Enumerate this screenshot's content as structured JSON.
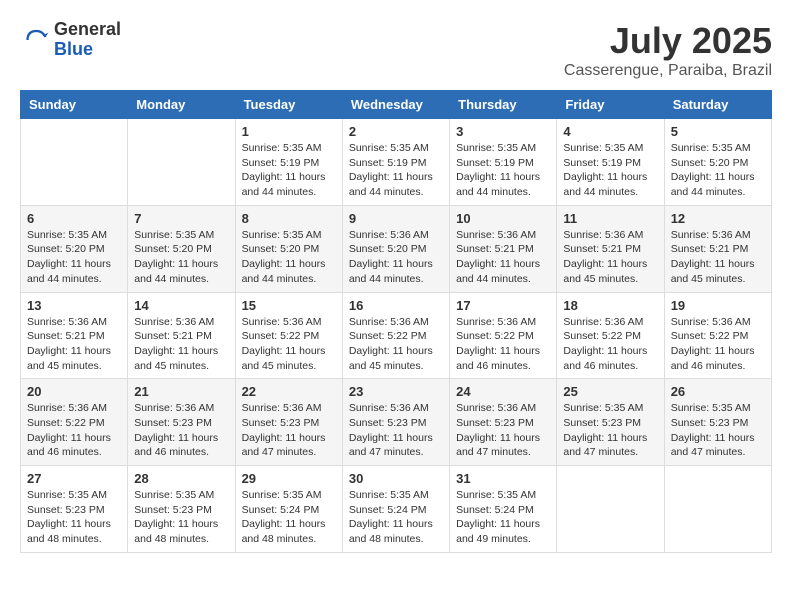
{
  "logo": {
    "general": "General",
    "blue": "Blue"
  },
  "title": {
    "month_year": "July 2025",
    "location": "Casserengue, Paraiba, Brazil"
  },
  "weekdays": [
    "Sunday",
    "Monday",
    "Tuesday",
    "Wednesday",
    "Thursday",
    "Friday",
    "Saturday"
  ],
  "weeks": [
    [
      {
        "day": "",
        "info": ""
      },
      {
        "day": "",
        "info": ""
      },
      {
        "day": "1",
        "info": "Sunrise: 5:35 AM\nSunset: 5:19 PM\nDaylight: 11 hours and 44 minutes."
      },
      {
        "day": "2",
        "info": "Sunrise: 5:35 AM\nSunset: 5:19 PM\nDaylight: 11 hours and 44 minutes."
      },
      {
        "day": "3",
        "info": "Sunrise: 5:35 AM\nSunset: 5:19 PM\nDaylight: 11 hours and 44 minutes."
      },
      {
        "day": "4",
        "info": "Sunrise: 5:35 AM\nSunset: 5:19 PM\nDaylight: 11 hours and 44 minutes."
      },
      {
        "day": "5",
        "info": "Sunrise: 5:35 AM\nSunset: 5:20 PM\nDaylight: 11 hours and 44 minutes."
      }
    ],
    [
      {
        "day": "6",
        "info": "Sunrise: 5:35 AM\nSunset: 5:20 PM\nDaylight: 11 hours and 44 minutes."
      },
      {
        "day": "7",
        "info": "Sunrise: 5:35 AM\nSunset: 5:20 PM\nDaylight: 11 hours and 44 minutes."
      },
      {
        "day": "8",
        "info": "Sunrise: 5:35 AM\nSunset: 5:20 PM\nDaylight: 11 hours and 44 minutes."
      },
      {
        "day": "9",
        "info": "Sunrise: 5:36 AM\nSunset: 5:20 PM\nDaylight: 11 hours and 44 minutes."
      },
      {
        "day": "10",
        "info": "Sunrise: 5:36 AM\nSunset: 5:21 PM\nDaylight: 11 hours and 44 minutes."
      },
      {
        "day": "11",
        "info": "Sunrise: 5:36 AM\nSunset: 5:21 PM\nDaylight: 11 hours and 45 minutes."
      },
      {
        "day": "12",
        "info": "Sunrise: 5:36 AM\nSunset: 5:21 PM\nDaylight: 11 hours and 45 minutes."
      }
    ],
    [
      {
        "day": "13",
        "info": "Sunrise: 5:36 AM\nSunset: 5:21 PM\nDaylight: 11 hours and 45 minutes."
      },
      {
        "day": "14",
        "info": "Sunrise: 5:36 AM\nSunset: 5:21 PM\nDaylight: 11 hours and 45 minutes."
      },
      {
        "day": "15",
        "info": "Sunrise: 5:36 AM\nSunset: 5:22 PM\nDaylight: 11 hours and 45 minutes."
      },
      {
        "day": "16",
        "info": "Sunrise: 5:36 AM\nSunset: 5:22 PM\nDaylight: 11 hours and 45 minutes."
      },
      {
        "day": "17",
        "info": "Sunrise: 5:36 AM\nSunset: 5:22 PM\nDaylight: 11 hours and 46 minutes."
      },
      {
        "day": "18",
        "info": "Sunrise: 5:36 AM\nSunset: 5:22 PM\nDaylight: 11 hours and 46 minutes."
      },
      {
        "day": "19",
        "info": "Sunrise: 5:36 AM\nSunset: 5:22 PM\nDaylight: 11 hours and 46 minutes."
      }
    ],
    [
      {
        "day": "20",
        "info": "Sunrise: 5:36 AM\nSunset: 5:22 PM\nDaylight: 11 hours and 46 minutes."
      },
      {
        "day": "21",
        "info": "Sunrise: 5:36 AM\nSunset: 5:23 PM\nDaylight: 11 hours and 46 minutes."
      },
      {
        "day": "22",
        "info": "Sunrise: 5:36 AM\nSunset: 5:23 PM\nDaylight: 11 hours and 47 minutes."
      },
      {
        "day": "23",
        "info": "Sunrise: 5:36 AM\nSunset: 5:23 PM\nDaylight: 11 hours and 47 minutes."
      },
      {
        "day": "24",
        "info": "Sunrise: 5:36 AM\nSunset: 5:23 PM\nDaylight: 11 hours and 47 minutes."
      },
      {
        "day": "25",
        "info": "Sunrise: 5:35 AM\nSunset: 5:23 PM\nDaylight: 11 hours and 47 minutes."
      },
      {
        "day": "26",
        "info": "Sunrise: 5:35 AM\nSunset: 5:23 PM\nDaylight: 11 hours and 47 minutes."
      }
    ],
    [
      {
        "day": "27",
        "info": "Sunrise: 5:35 AM\nSunset: 5:23 PM\nDaylight: 11 hours and 48 minutes."
      },
      {
        "day": "28",
        "info": "Sunrise: 5:35 AM\nSunset: 5:23 PM\nDaylight: 11 hours and 48 minutes."
      },
      {
        "day": "29",
        "info": "Sunrise: 5:35 AM\nSunset: 5:24 PM\nDaylight: 11 hours and 48 minutes."
      },
      {
        "day": "30",
        "info": "Sunrise: 5:35 AM\nSunset: 5:24 PM\nDaylight: 11 hours and 48 minutes."
      },
      {
        "day": "31",
        "info": "Sunrise: 5:35 AM\nSunset: 5:24 PM\nDaylight: 11 hours and 49 minutes."
      },
      {
        "day": "",
        "info": ""
      },
      {
        "day": "",
        "info": ""
      }
    ]
  ]
}
